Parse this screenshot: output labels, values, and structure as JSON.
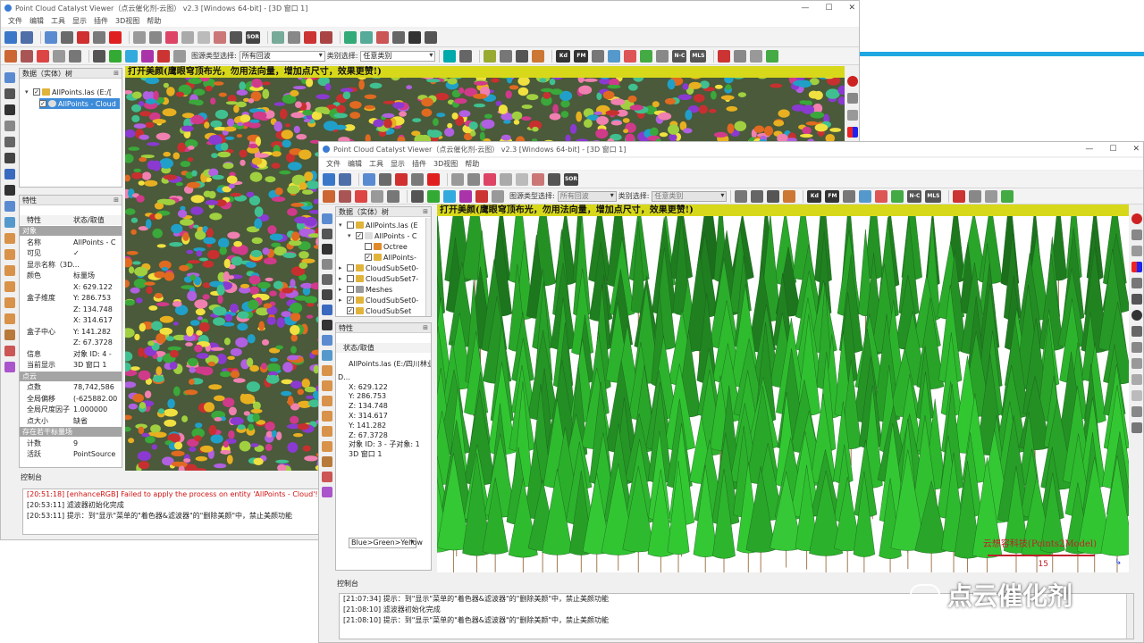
{
  "window1": {
    "title": "Point Cloud Catalyst Viewer（点云催化剂-云图） v2.3 [Windows 64-bit] - [3D 窗口 1]",
    "menu": [
      "文件",
      "编辑",
      "工具",
      "显示",
      "插件",
      "3D视图",
      "帮助"
    ],
    "toolbar1_sor": "SOR",
    "toolbar2": {
      "type_label": "图源类型选择:",
      "type_value": "所有回波",
      "class_label": "类别选择:",
      "class_value": "任意类别",
      "kd": "Kd",
      "fm": "FM",
      "nc": "N-C",
      "mls": "MLS"
    },
    "db_panel": {
      "title": "数据（实体）树",
      "items": [
        {
          "label": "AllPoints.las (E:/[",
          "checked": "✓"
        },
        {
          "label": "AllPoints - Cloud",
          "checked": "✓"
        }
      ]
    },
    "props_panel": {
      "title": "特性",
      "header_key": "特性",
      "header_val": "状态/取值",
      "rows": [
        {
          "type": "sect",
          "k": "对象"
        },
        {
          "k": "名称",
          "v": "AllPoints - C"
        },
        {
          "k": "可见",
          "v": "✓"
        },
        {
          "k": "显示名称（3D...",
          "v": ""
        },
        {
          "k": "颜色",
          "v": "标量场"
        },
        {
          "k": "",
          "v": "X: 629.122"
        },
        {
          "k": "盒子维度",
          "v": "Y: 286.753"
        },
        {
          "k": "",
          "v": "Z: 134.748"
        },
        {
          "k": "",
          "v": "X: 314.617"
        },
        {
          "k": "盒子中心",
          "v": "Y: 141.282"
        },
        {
          "k": "",
          "v": "Z: 67.3728"
        },
        {
          "k": "信息",
          "v": "对象 ID: 4 - "
        },
        {
          "k": "当前显示",
          "v": "3D 窗口 1"
        },
        {
          "type": "sect",
          "k": "点云"
        },
        {
          "k": "点数",
          "v": "78,742,586"
        },
        {
          "k": "全局偏移",
          "v": "(-625882.00"
        },
        {
          "k": "全局尺度因子",
          "v": "1.000000"
        },
        {
          "k": "点大小",
          "v": "缺省"
        },
        {
          "type": "sect",
          "k": "存在若干标量场"
        },
        {
          "k": "计数",
          "v": "9"
        },
        {
          "k": "活跃",
          "v": "PointSource"
        }
      ]
    },
    "banner": "打开美颜(鹰眼穹顶布光，勿用法向量，增加点尺寸，效果更赞!)",
    "console_title": "控制台",
    "console": [
      "[20:51:18] [enhanceRGB] Failed to apply the process on entity 'AllPoints - Cloud'!",
      "[20:53:11] 滤波器初始化完成",
      "[20:53:11] 提示：到\"显示\"菜单的\"着色器&滤波器\"的\"删除美颜\"中，禁止美颜功能"
    ]
  },
  "window2": {
    "title": "Point Cloud Catalyst Viewer（点云催化剂-云图） v2.3 [Windows 64-bit] - [3D 窗口 1]",
    "menu": [
      "文件",
      "编辑",
      "工具",
      "显示",
      "插件",
      "3D视图",
      "帮助"
    ],
    "toolbar1_sor": "SOR",
    "toolbar2": {
      "type_label": "图源类型选择:",
      "type_value": "所有回波",
      "class_label": "类别选择:",
      "class_value": "任意类别",
      "kd": "Kd",
      "fm": "FM",
      "nc": "N-C",
      "mls": "MLS"
    },
    "db_panel": {
      "title": "数据（实体）树",
      "items": [
        {
          "label": "AllPoints.las (E",
          "checked": "",
          "indent": 0,
          "exp": "▾"
        },
        {
          "label": "AllPoints - C",
          "checked": "✓",
          "indent": 1,
          "exp": "▾"
        },
        {
          "label": "Octree",
          "checked": "",
          "indent": 2,
          "exp": ""
        },
        {
          "label": "AllPoints-",
          "checked": "✓",
          "indent": 2,
          "exp": ""
        },
        {
          "label": "CloudSubSet0-",
          "checked": "",
          "indent": 0,
          "exp": "▸"
        },
        {
          "label": "CloudSubSet7-",
          "checked": "",
          "indent": 0,
          "exp": "▸"
        },
        {
          "label": "Meshes",
          "checked": "",
          "indent": 0,
          "exp": "▸"
        },
        {
          "label": "CloudSubSet0-",
          "checked": "✓",
          "indent": 0,
          "exp": "▸"
        },
        {
          "label": "CloudSubSet",
          "checked": "✓",
          "indent": 0,
          "exp": ""
        }
      ]
    },
    "props_panel": {
      "title": "特性",
      "header_val": "状态/取值",
      "rows": [
        {
          "k": "",
          "v": "AllPoints.las (E:/四川林业/..."
        },
        {
          "k": "D...",
          "v": ""
        },
        {
          "k": "",
          "v": "X: 629.122"
        },
        {
          "k": "",
          "v": "Y: 286.753"
        },
        {
          "k": "",
          "v": "Z: 134.748"
        },
        {
          "k": "",
          "v": "X: 314.617"
        },
        {
          "k": "",
          "v": "Y: 141.282"
        },
        {
          "k": "",
          "v": "Z: 67.3728"
        },
        {
          "k": "",
          "v": "对象 ID: 3 - 子对象: 1"
        },
        {
          "k": "",
          "v": "3D 窗口 1"
        }
      ],
      "colormap": "Blue>Green>Yellow"
    },
    "banner": "打开美颜(鹰眼穹顶布光，勿用法向量，增加点尺寸，效果更赞!)",
    "watermark": "云想容科技(Points2Model)",
    "scale_value": "15",
    "console_title": "控制台",
    "console": [
      "[21:07:34] 提示：到\"显示\"菜单的\"着色器&滤波器\"的\"删除美颜\"中，禁止美颜功能",
      "[21:08:10] 滤波器初始化完成",
      "[21:08:10] 提示：到\"显示\"菜单的\"着色器&滤波器\"的\"删除美颜\"中，禁止美颜功能"
    ]
  },
  "brand_watermark": "点云催化剂",
  "colors": {
    "banner": "#d8d81a",
    "tree_green": "#2f9a2f",
    "accent": "#1ea7e1"
  }
}
